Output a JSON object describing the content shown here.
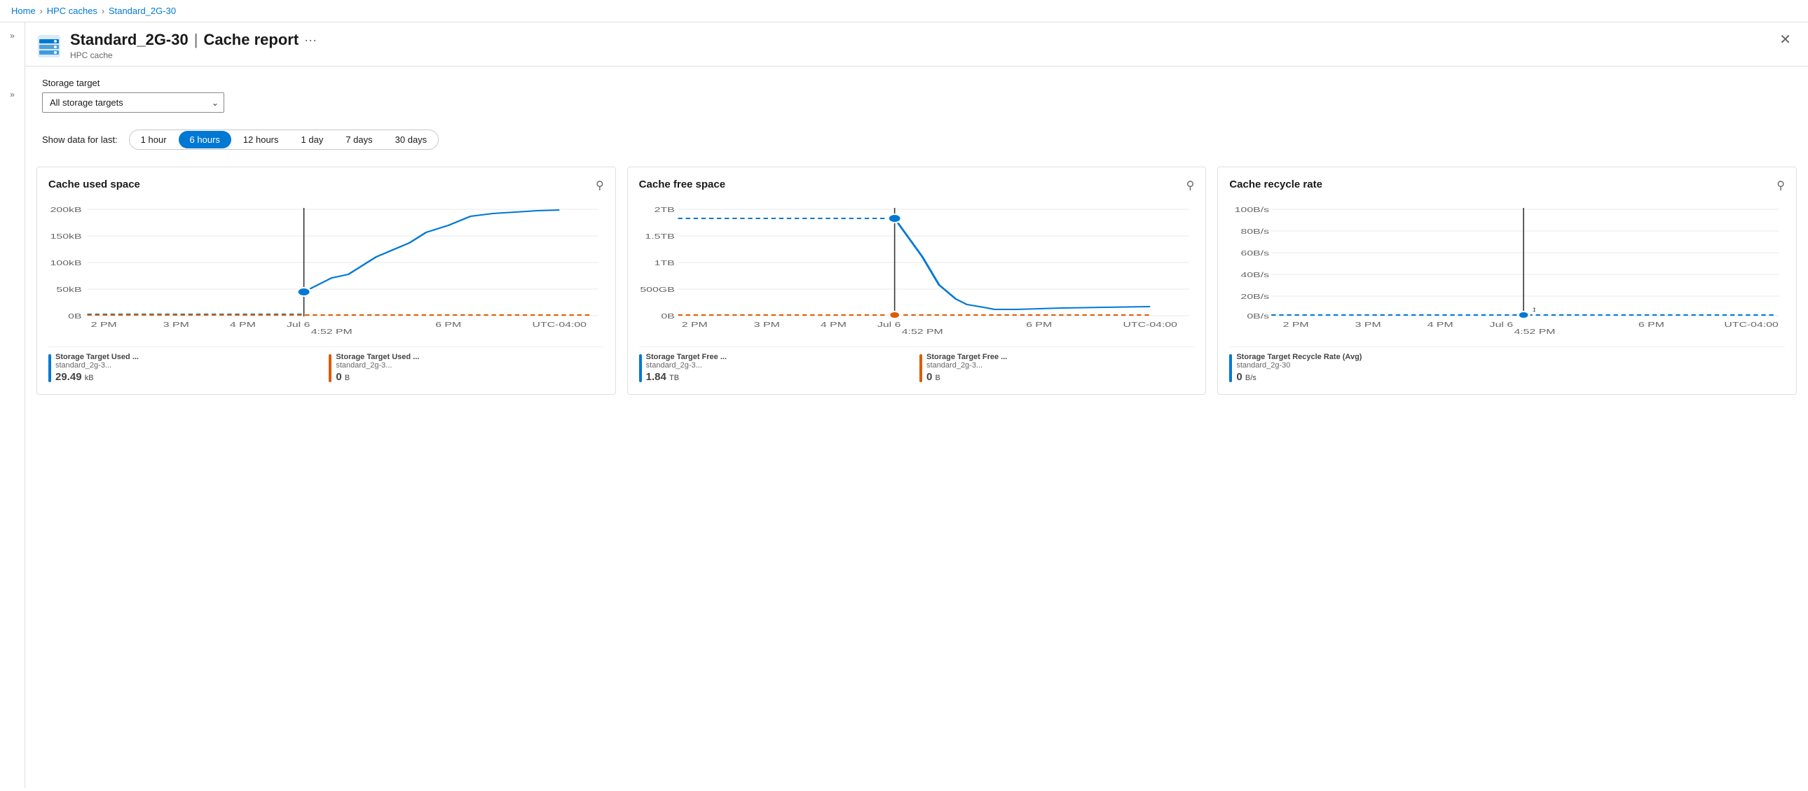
{
  "breadcrumb": {
    "home": "Home",
    "hpc_caches": "HPC caches",
    "current": "Standard_2G-30"
  },
  "header": {
    "title": "Standard_2G-30",
    "separator": "|",
    "subtitle_right": "Cache report",
    "resource_type": "HPC cache",
    "more_label": "···",
    "close_label": "✕"
  },
  "filter": {
    "label": "Storage target",
    "dropdown_value": "All storage targets",
    "dropdown_placeholder": "All storage targets"
  },
  "time_filter": {
    "label": "Show data for last:",
    "options": [
      "1 hour",
      "6 hours",
      "12 hours",
      "1 day",
      "7 days",
      "30 days"
    ],
    "active": "6 hours"
  },
  "charts": [
    {
      "id": "cache-used-space",
      "title": "Cache used space",
      "y_labels": [
        "200kB",
        "150kB",
        "100kB",
        "50kB",
        "0B"
      ],
      "x_labels": [
        "2 PM",
        "3 PM",
        "4 PM",
        "Jul 6",
        "4:52 PM",
        "6 PM",
        "UTC-04:00"
      ],
      "legend": [
        {
          "color": "#0078d4",
          "name": "Storage Target Used ...",
          "sub": "standard_2g-3...",
          "value": "29.49",
          "unit": "kB"
        },
        {
          "color": "#e05a00",
          "name": "Storage Target Used ...",
          "sub": "standard_2g-3...",
          "value": "0",
          "unit": "B"
        }
      ]
    },
    {
      "id": "cache-free-space",
      "title": "Cache free space",
      "y_labels": [
        "2TB",
        "1.5TB",
        "1TB",
        "500GB",
        "0B"
      ],
      "x_labels": [
        "2 PM",
        "3 PM",
        "4 PM",
        "Jul 6",
        "4:52 PM",
        "6 PM",
        "UTC-04:00"
      ],
      "legend": [
        {
          "color": "#0078d4",
          "name": "Storage Target Free ...",
          "sub": "standard_2g-3...",
          "value": "1.84",
          "unit": "TB"
        },
        {
          "color": "#e05a00",
          "name": "Storage Target Free ...",
          "sub": "standard_2g-3...",
          "value": "0",
          "unit": "B"
        }
      ]
    },
    {
      "id": "cache-recycle-rate",
      "title": "Cache recycle rate",
      "y_labels": [
        "100B/s",
        "80B/s",
        "60B/s",
        "40B/s",
        "20B/s",
        "0B/s"
      ],
      "x_labels": [
        "2 PM",
        "3 PM",
        "4 PM",
        "Jul 6",
        "4:52 PM",
        "6 PM",
        "UTC-04:00"
      ],
      "legend": [
        {
          "color": "#0078d4",
          "name": "Storage Target Recycle Rate (Avg)",
          "sub": "standard_2g-30",
          "value": "0",
          "unit": "B/s"
        }
      ]
    }
  ],
  "icons": {
    "chevron_right": "›",
    "chevron_double": "»",
    "dropdown_arrow": "⌄",
    "pin": "⚲",
    "more": "…"
  }
}
